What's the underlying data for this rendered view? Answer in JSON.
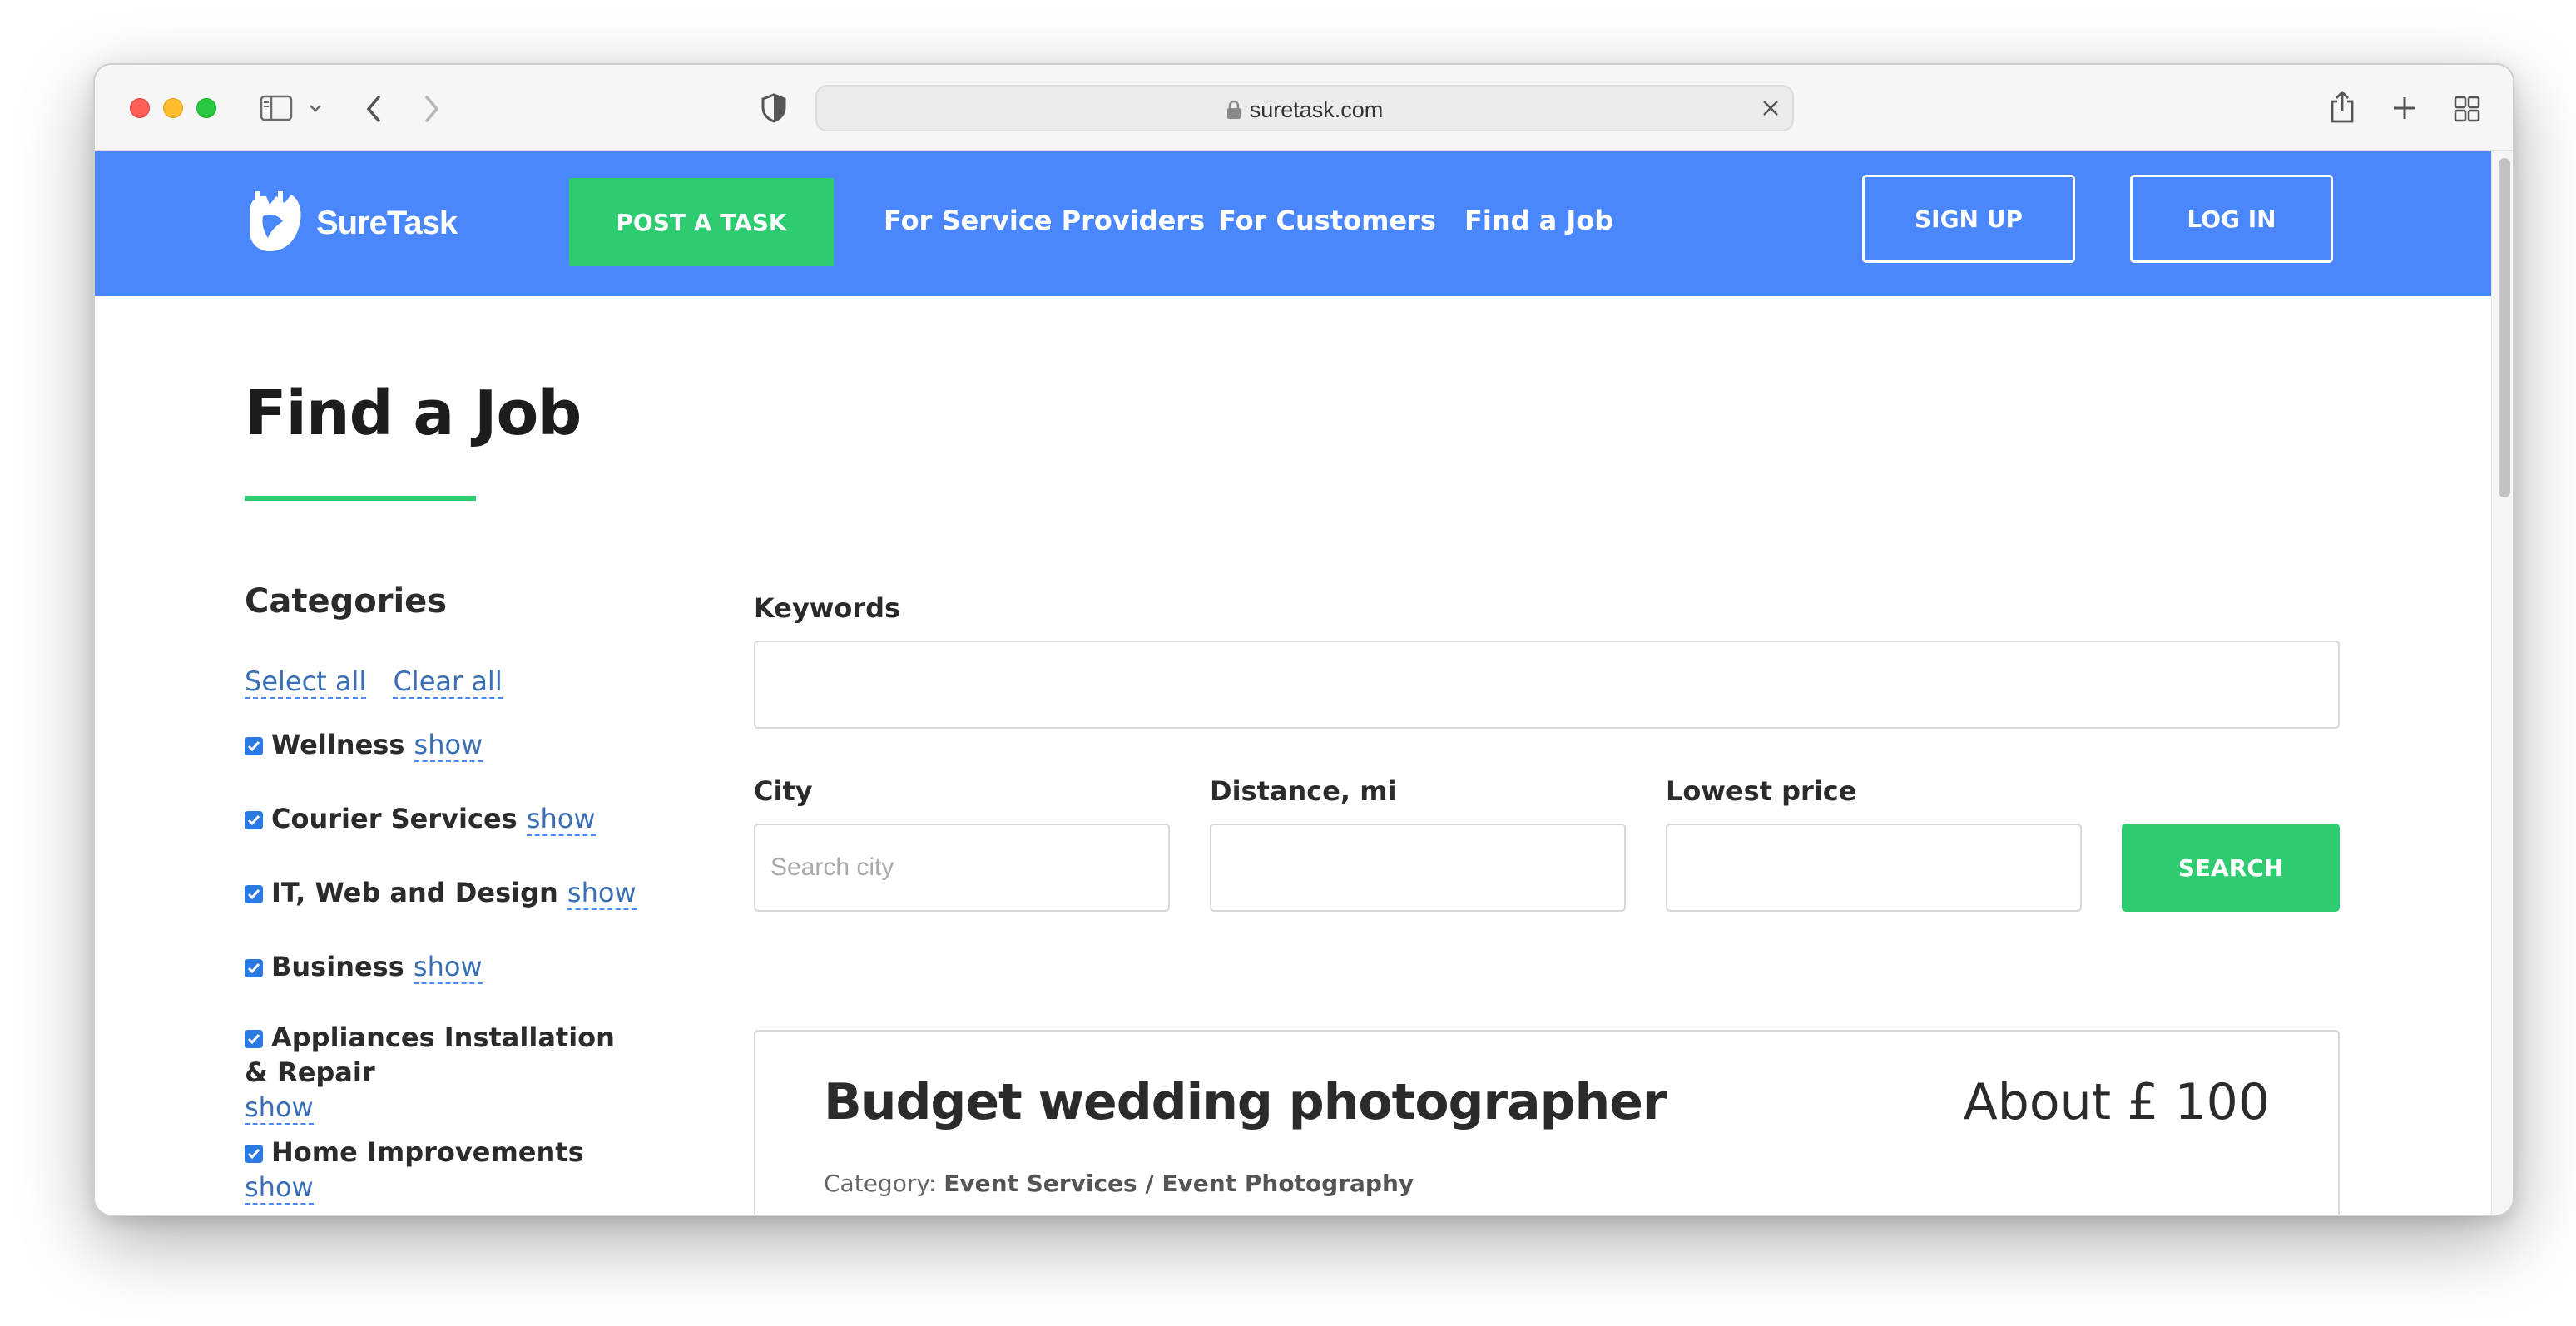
{
  "browser": {
    "url": "suretask.com"
  },
  "header": {
    "brand": "SureTask",
    "post_task": "POST A TASK",
    "nav": [
      "For Service Providers",
      "For Customers",
      "Find a Job"
    ],
    "sign_up": "SIGN UP",
    "log_in": "LOG IN"
  },
  "page": {
    "title": "Find a Job"
  },
  "sidebar": {
    "heading": "Categories",
    "select_all": "Select all",
    "clear_all": "Clear all",
    "show_label": "show",
    "categories": [
      {
        "name": "Wellness",
        "checked": true
      },
      {
        "name": "Courier Services",
        "checked": true
      },
      {
        "name": "IT, Web and Design",
        "checked": true
      },
      {
        "name": "Business",
        "checked": true
      },
      {
        "name": "Appliances Installation & Repair",
        "checked": true
      },
      {
        "name": "Home Improvements",
        "checked": true
      }
    ]
  },
  "search": {
    "keywords_label": "Keywords",
    "keywords_value": "",
    "city_label": "City",
    "city_placeholder": "Search city",
    "distance_label": "Distance, mi",
    "distance_value": "",
    "price_label": "Lowest price",
    "price_value": "",
    "button": "SEARCH"
  },
  "jobs": [
    {
      "title": "Budget wedding photographer",
      "price": "About £ 100",
      "category_label": "Category:",
      "category": "Event Services / Event Photography"
    }
  ],
  "colors": {
    "header_bg": "#4a86fc",
    "accent_green": "#2ecc71",
    "link": "#3a6fb5"
  }
}
